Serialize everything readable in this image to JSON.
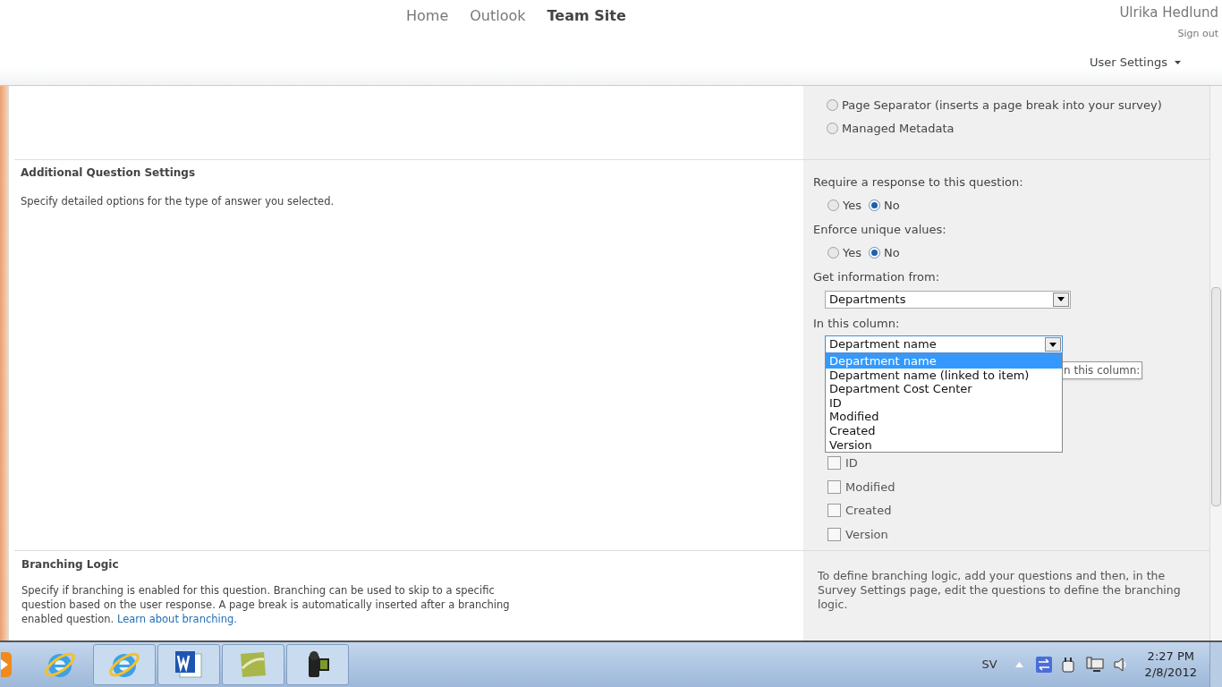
{
  "nav": {
    "links": [
      {
        "label": "Home",
        "selected": false
      },
      {
        "label": "Outlook",
        "selected": false
      },
      {
        "label": "Team Site",
        "selected": true
      }
    ]
  },
  "user": {
    "name": "Ulrika Hedlund",
    "sign_out": "Sign out",
    "settings_menu": "User Settings"
  },
  "answer_types": [
    {
      "label": "Page Separator (inserts a page break into your survey)",
      "selected": false
    },
    {
      "label": "Managed Metadata",
      "selected": false
    }
  ],
  "additional_settings": {
    "title": "Additional Question Settings",
    "description": "Specify detailed options for the type of answer you selected.",
    "require_response": {
      "label": "Require a response to this question:",
      "options": [
        {
          "label": "Yes",
          "selected": false
        },
        {
          "label": "No",
          "selected": true
        }
      ]
    },
    "unique_values": {
      "label": "Enforce unique values:",
      "options": [
        {
          "label": "Yes",
          "selected": false
        },
        {
          "label": "No",
          "selected": true
        }
      ]
    },
    "source_list": {
      "label": "Get information from:",
      "value": "Departments"
    },
    "column": {
      "label": "In this column:",
      "value": "Department name",
      "expanded": true,
      "options": [
        {
          "label": "Department name",
          "selected": true
        },
        {
          "label": "Department name (linked to item)",
          "selected": false
        },
        {
          "label": "Department Cost Center",
          "selected": false
        },
        {
          "label": "ID",
          "selected": false
        },
        {
          "label": "Modified",
          "selected": false
        },
        {
          "label": "Created",
          "selected": false
        },
        {
          "label": "Version",
          "selected": false
        }
      ],
      "tooltip": "n this column:"
    },
    "additional_fields": [
      {
        "label": "ID",
        "checked": false
      },
      {
        "label": "Modified",
        "checked": false
      },
      {
        "label": "Created",
        "checked": false
      },
      {
        "label": "Version",
        "checked": false
      }
    ]
  },
  "branching": {
    "title": "Branching Logic",
    "description": "Specify if branching is enabled for this question. Branching can be used to skip to a specific question based on the user response. A page break is automatically inserted after a branching enabled question.",
    "link": "Learn about branching.",
    "note": "To define branching logic, add your questions and then, in the Survey Settings page, edit the questions to define the branching logic."
  },
  "taskbar": {
    "apps": [
      {
        "kind": "media",
        "running": false
      },
      {
        "kind": "browser",
        "running": false
      },
      {
        "kind": "browser",
        "running": true
      },
      {
        "kind": "word",
        "running": true
      },
      {
        "kind": "green",
        "running": true
      },
      {
        "kind": "camera",
        "running": true
      }
    ],
    "language": "SV",
    "time": "2:27 PM",
    "date": "2/8/2012"
  }
}
